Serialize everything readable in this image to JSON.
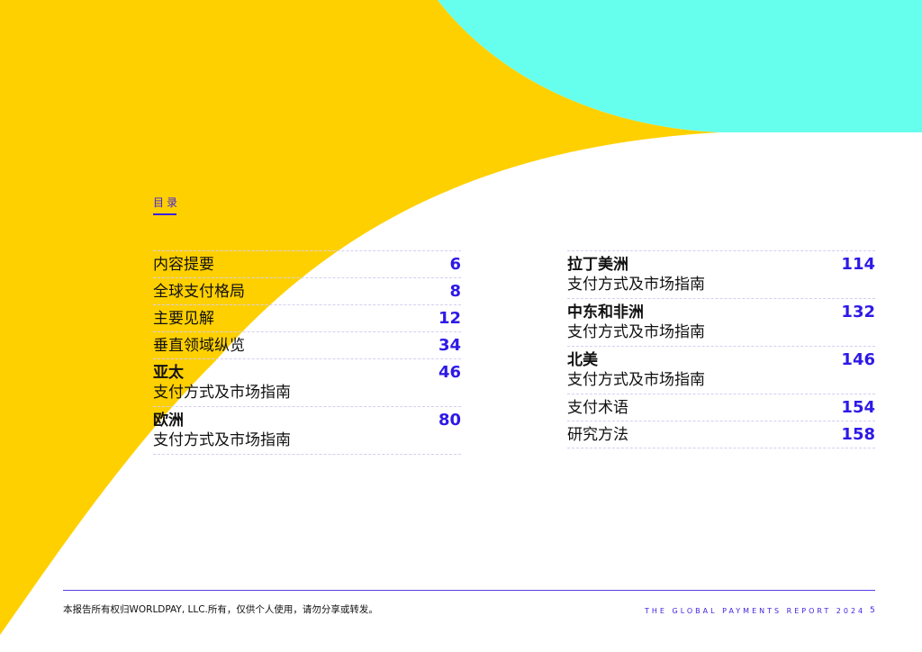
{
  "colors": {
    "yellow": "#ffd000",
    "cyan": "#66ffee",
    "accent": "#2e19e6"
  },
  "toc": {
    "title": "目录",
    "left": [
      {
        "title": "内容提要",
        "subtitle": "",
        "page": "6",
        "bold": false
      },
      {
        "title": "全球支付格局",
        "subtitle": "",
        "page": "8",
        "bold": false
      },
      {
        "title": "主要见解",
        "subtitle": "",
        "page": "12",
        "bold": false
      },
      {
        "title": "垂直领域纵览",
        "subtitle": "",
        "page": "34",
        "bold": false
      },
      {
        "title": "亚太",
        "subtitle": "支付方式及市场指南",
        "page": "46",
        "bold": true
      },
      {
        "title": "欧洲",
        "subtitle": "支付方式及市场指南",
        "page": "80",
        "bold": true
      }
    ],
    "right": [
      {
        "title": "拉丁美洲",
        "subtitle": "支付方式及市场指南",
        "page": "114",
        "bold": true
      },
      {
        "title": "中东和非洲",
        "subtitle": "支付方式及市场指南",
        "page": "132",
        "bold": true
      },
      {
        "title": "北美",
        "subtitle": "支付方式及市场指南",
        "page": "146",
        "bold": true
      },
      {
        "title": "支付术语",
        "subtitle": "",
        "page": "154",
        "bold": false
      },
      {
        "title": "研究方法",
        "subtitle": "",
        "page": "158",
        "bold": false
      }
    ]
  },
  "footer": {
    "copyright": "本报告所有权归WORLDPAY, LLC.所有，仅供个人使用，请勿分享或转发。",
    "report_name": "THE GLOBAL PAYMENTS REPORT 2024",
    "page_number": "5"
  }
}
